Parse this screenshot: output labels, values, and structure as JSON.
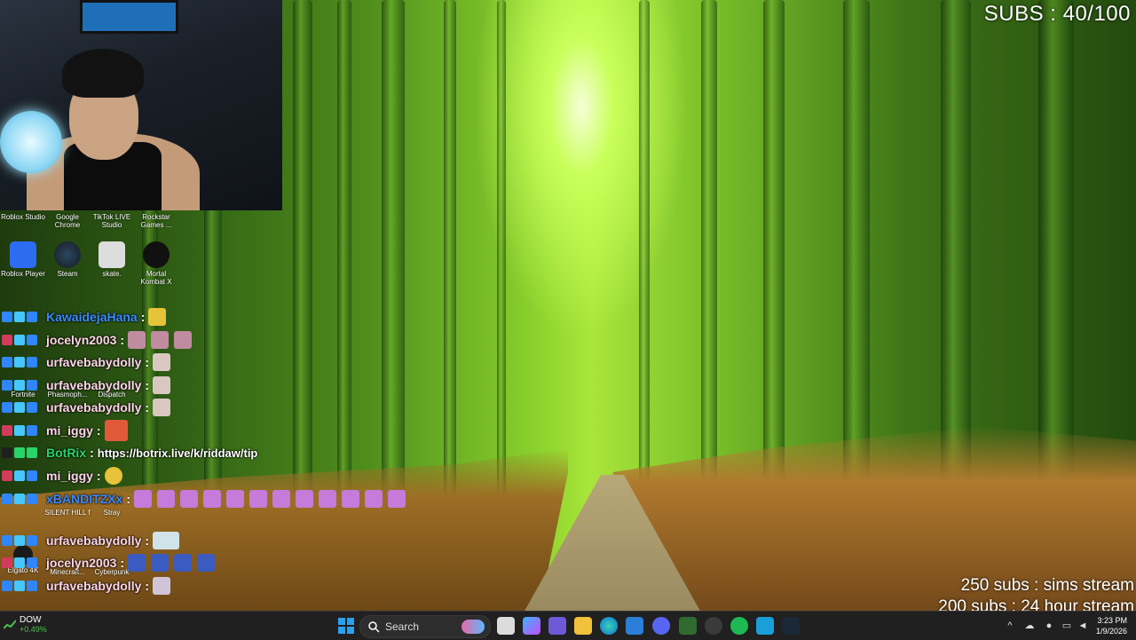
{
  "overlay": {
    "subs_counter": "SUBS : 40/100",
    "goals": [
      "250 subs : sims stream",
      "200 subs : 24 hour stream"
    ]
  },
  "desktop_icons": [
    {
      "label": "Roblox Studio",
      "icon": "roblox-studio-icon"
    },
    {
      "label": "Google Chrome",
      "icon": "chrome-icon"
    },
    {
      "label": "TikTok LIVE Studio",
      "icon": "tiktok-live-icon"
    },
    {
      "label": "Rockstar Games ...",
      "icon": "rockstar-icon"
    },
    {
      "label": "Roblox Player",
      "icon": "roblox-icon"
    },
    {
      "label": "Steam",
      "icon": "steam-icon"
    },
    {
      "label": "skate.",
      "icon": "skate-icon"
    },
    {
      "label": "Mortal Kombat X",
      "icon": "mortal-kombat-icon"
    },
    {
      "label": "Fortnite",
      "icon": "fortnite-icon"
    },
    {
      "label": "Phasmoph...",
      "icon": "phasmophobia-icon"
    },
    {
      "label": "Dispatch",
      "icon": "dispatch-icon"
    },
    {
      "label": "SILENT HILL f",
      "icon": "silent-hill-icon"
    },
    {
      "label": "Stray",
      "icon": "stray-icon"
    },
    {
      "label": "Elgato 4K",
      "icon": "elgato-icon"
    },
    {
      "label": "Minecraft...",
      "icon": "minecraft-icon"
    },
    {
      "label": "Cyberpunk",
      "icon": "cyberpunk-icon"
    }
  ],
  "chat": [
    {
      "user": "KawaidejaHana",
      "color": "#3b8bff",
      "text": ""
    },
    {
      "user": "jocelyn2003",
      "color": "#ffd6e8",
      "text": ""
    },
    {
      "user": "urfavebabydolly",
      "color": "#ffd6e8",
      "text": ""
    },
    {
      "user": "urfavebabydolly",
      "color": "#ffd6e8",
      "text": ""
    },
    {
      "user": "urfavebabydolly",
      "color": "#ffd6e8",
      "text": ""
    },
    {
      "user": "mi_iggy",
      "color": "#ffd6e8",
      "text": ""
    },
    {
      "user": "BotRix",
      "color": "#2bd46b",
      "text": "https://botrix.live/k/riddaw/tip"
    },
    {
      "user": "mi_iggy",
      "color": "#ffd6e8",
      "text": ""
    },
    {
      "user": "xBANDITZXx",
      "color": "#3b8bff",
      "text": ""
    },
    {
      "user": "urfavebabydolly",
      "color": "#ffd6e8",
      "text": ""
    },
    {
      "user": "jocelyn2003",
      "color": "#ffd6e8",
      "text": ""
    },
    {
      "user": "urfavebabydolly",
      "color": "#ffd6e8",
      "text": ""
    }
  ],
  "taskbar": {
    "stock_name": "DOW",
    "stock_change": "+0.49%",
    "search_label": "Search",
    "time": "3:23 PM",
    "date": "1/9/2026"
  }
}
